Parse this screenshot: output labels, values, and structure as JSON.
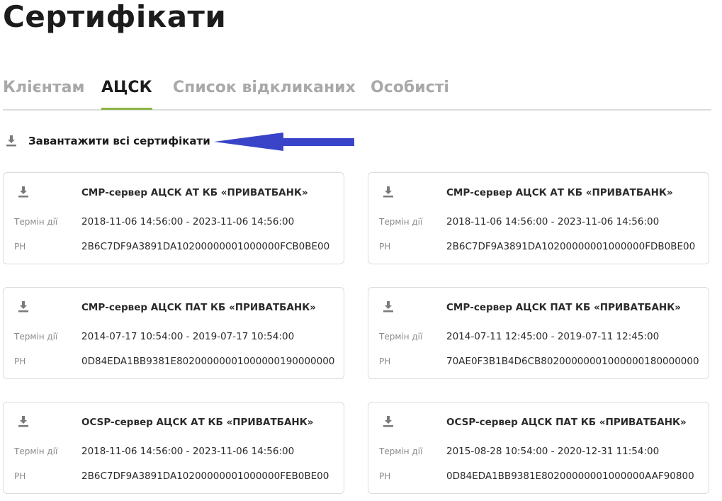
{
  "page": {
    "title": "Сертифікати"
  },
  "tabs": [
    {
      "label": "Клієнтам",
      "active": false
    },
    {
      "label": "АЦСК",
      "active": true
    },
    {
      "label": "Список відкликаних",
      "active": false
    },
    {
      "label": "Особисті",
      "active": false
    }
  ],
  "download_all": {
    "label": "Завантажити всі сертифікати",
    "icon": "download-icon"
  },
  "annotation": {
    "arrow_color": "#3a44c9"
  },
  "colors": {
    "active_tab_underline": "#8bb544"
  },
  "labels": {
    "term": "Термін дії",
    "serial": "РН"
  },
  "certificates": [
    {
      "title": "СМР-сервер АЦСК АТ КБ «ПРИВАТБАНК»",
      "term": "2018-11-06 14:56:00 - 2023-11-06 14:56:00",
      "serial": "2B6C7DF9A3891DA10200000001000000FCB0BE00"
    },
    {
      "title": "СМР-сервер АЦСК АТ КБ «ПРИВАТБАНК»",
      "term": "2018-11-06 14:56:00 - 2023-11-06 14:56:00",
      "serial": "2B6C7DF9A3891DA10200000001000000FDB0BE00"
    },
    {
      "title": "СМР-сервер АЦСК ПАТ КБ «ПРИВАТБАНК»",
      "term": "2014-07-17 10:54:00 - 2019-07-17 10:54:00",
      "serial": "0D84EDA1BB9381E80200000001000000190000000"
    },
    {
      "title": "СМР-сервер АЦСК ПАТ КБ «ПРИВАТБАНК»",
      "term": "2014-07-11 12:45:00 - 2019-07-11 12:45:00",
      "serial": "70AE0F3B1B4D6CB80200000001000000180000000"
    },
    {
      "title": "OCSP-сервер АЦСК АТ КБ «ПРИВАТБАНК»",
      "term": "2018-11-06 14:56:00 - 2023-11-06 14:56:00",
      "serial": "2B6C7DF9A3891DA10200000001000000FEB0BE00"
    },
    {
      "title": "OCSP-сервер АЦСК ПАТ КБ «ПРИВАТБАНК»",
      "term": "2015-08-28 10:54:00 - 2020-12-31 11:54:00",
      "serial": "0D84EDA1BB9381E80200000001000000AAF90800"
    }
  ]
}
